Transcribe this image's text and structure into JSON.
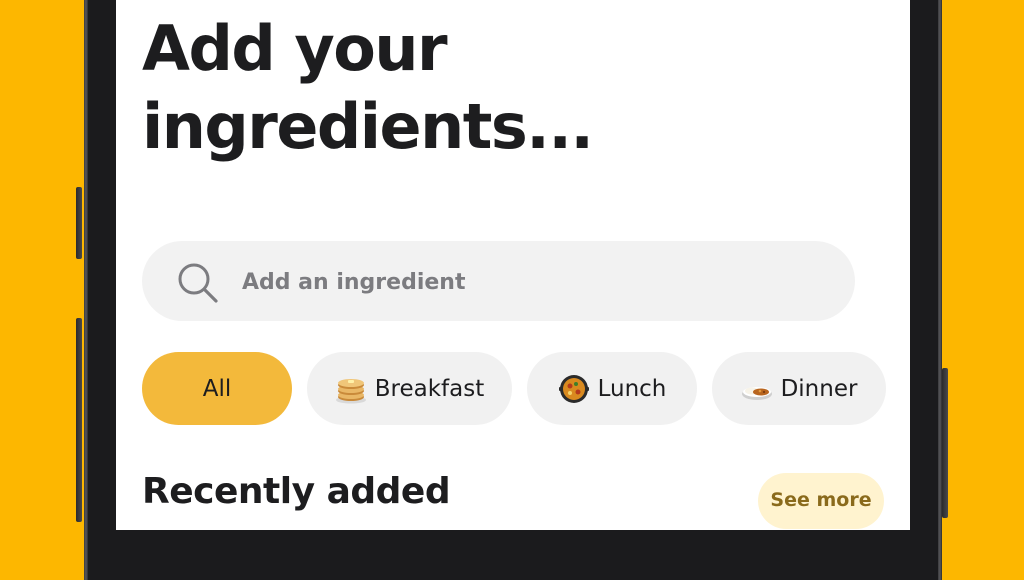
{
  "colors": {
    "background": "#FDB700",
    "accent_chip": "#F3B93B",
    "see_more_bg": "#FFF3CF",
    "see_more_text": "#8a6a1c",
    "title_text": "#1d1d1f"
  },
  "page": {
    "title_line1": "Add your",
    "title_line2": "ingredients..."
  },
  "search": {
    "placeholder": "Add an ingredient",
    "value": "",
    "icon": "search-icon"
  },
  "filters": [
    {
      "label": "All",
      "icon": "",
      "selected": true
    },
    {
      "label": "Breakfast",
      "icon": "pancakes-icon",
      "selected": false
    },
    {
      "label": "Lunch",
      "icon": "paella-pan-icon",
      "selected": false
    },
    {
      "label": "Dinner",
      "icon": "curry-rice-icon",
      "selected": false
    }
  ],
  "recent": {
    "header": "Recently added",
    "see_more_label": "See more"
  }
}
